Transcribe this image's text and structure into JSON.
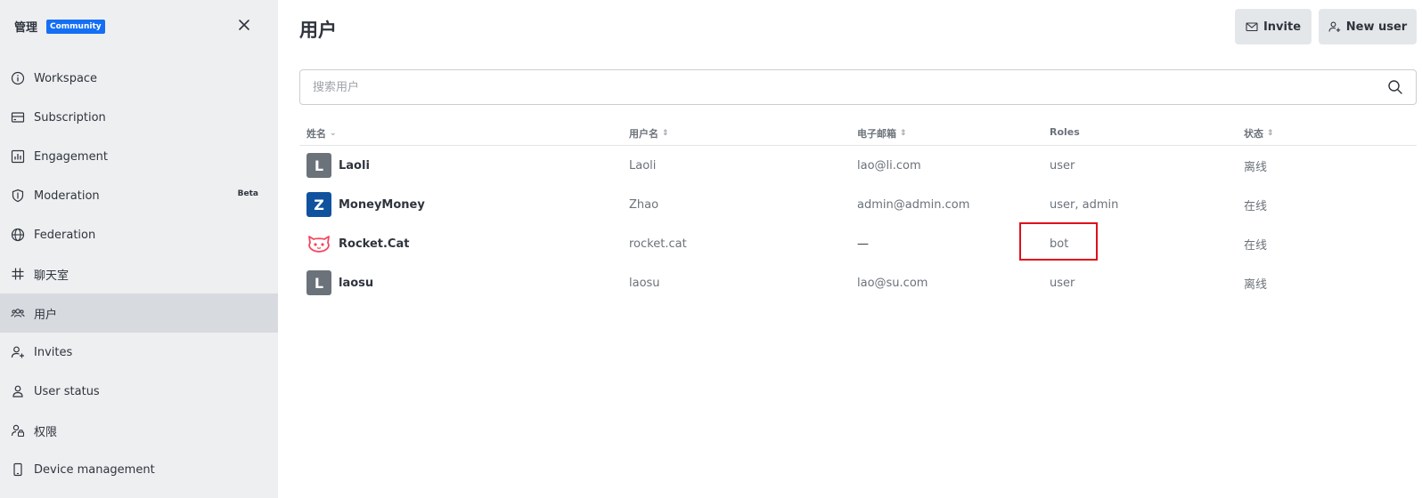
{
  "sidebar": {
    "title": "管理",
    "badge": "Community",
    "items": [
      {
        "label": "Workspace",
        "icon": "info-icon"
      },
      {
        "label": "Subscription",
        "icon": "card-icon"
      },
      {
        "label": "Engagement",
        "icon": "chart-icon"
      },
      {
        "label": "Moderation",
        "icon": "shield-icon",
        "tag": "Beta"
      },
      {
        "label": "Federation",
        "icon": "globe-icon"
      },
      {
        "label": "聊天室",
        "icon": "hash-icon"
      },
      {
        "label": "用户",
        "icon": "team-icon",
        "active": true
      },
      {
        "label": "Invites",
        "icon": "user-plus-icon"
      },
      {
        "label": "User status",
        "icon": "user-icon"
      },
      {
        "label": "权限",
        "icon": "user-lock-icon"
      },
      {
        "label": "Device management",
        "icon": "mobile-icon"
      }
    ]
  },
  "header": {
    "title": "用户",
    "invite_label": "Invite",
    "new_user_label": "New user"
  },
  "search": {
    "placeholder": "搜索用户"
  },
  "table": {
    "columns": [
      {
        "label": "姓名",
        "sortable": true
      },
      {
        "label": "用户名",
        "sortable": true
      },
      {
        "label": "电子邮箱",
        "sortable": true
      },
      {
        "label": "Roles",
        "sortable": false
      },
      {
        "label": "状态",
        "sortable": true
      }
    ],
    "rows": [
      {
        "initial": "L",
        "avatar_color": "#6c727a",
        "name": "Laoli",
        "username": "Laoli",
        "email": "lao@li.com",
        "roles": "user",
        "status": "离线"
      },
      {
        "initial": "Z",
        "avatar_color": "#10529e",
        "name": "MoneyMoney",
        "username": "Zhao",
        "email": "admin@admin.com",
        "roles": "user, admin",
        "status": "在线"
      },
      {
        "initial": "",
        "avatar_color": "#f5455c",
        "name": "Rocket.Cat",
        "username": "rocket.cat",
        "email": "—",
        "roles": "bot",
        "status": "在线"
      },
      {
        "initial": "L",
        "avatar_color": "#6c727a",
        "name": "laosu",
        "username": "laosu",
        "email": "lao@su.com",
        "roles": "user",
        "status": "离线"
      }
    ]
  },
  "colors": {
    "highlight": "#e0101a",
    "badge": "#156ff5"
  }
}
